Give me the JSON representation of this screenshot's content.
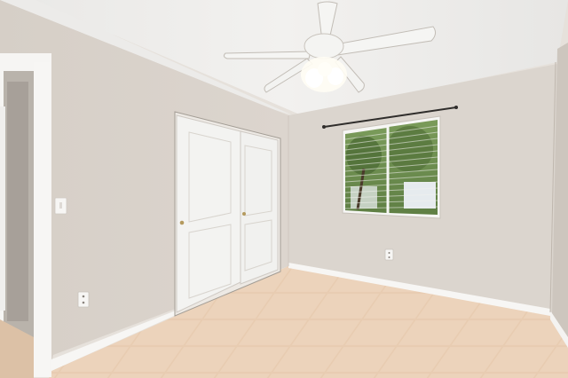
{
  "scene": {
    "description_colors": {
      "ceiling": "#efeeec",
      "wall_left": "#d8d1ca",
      "wall_back": "#dcd6cf",
      "wall_right": "#cfc8c0",
      "floor": "#e9cdb3",
      "trim": "#f7f6f4",
      "door": "#f2f2f0"
    },
    "fixtures": {
      "ceiling_fan": "ceiling-fan",
      "closet": "sliding-closet-doors",
      "window": "window-with-blinds",
      "curtain_rod": "curtain-rod",
      "outlets": 2,
      "light_switch": 1
    }
  }
}
